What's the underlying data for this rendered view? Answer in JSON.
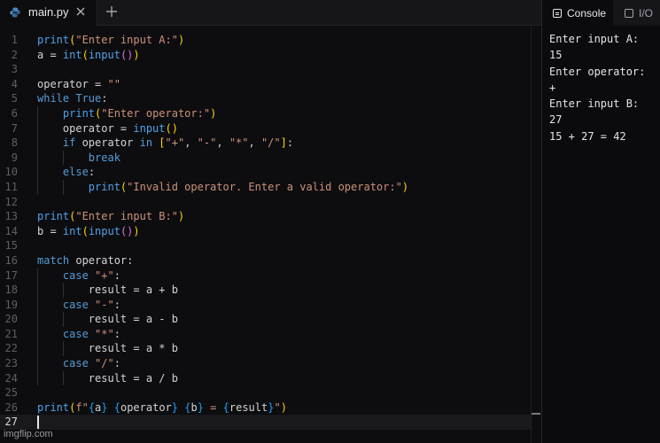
{
  "editor": {
    "tab_title": "main.py",
    "lines": [
      "1",
      "2",
      "3",
      "4",
      "5",
      "6",
      "7",
      "8",
      "9",
      "10",
      "11",
      "12",
      "13",
      "14",
      "15",
      "16",
      "17",
      "18",
      "19",
      "20",
      "21",
      "22",
      "23",
      "24",
      "25",
      "26",
      "27"
    ]
  },
  "console": {
    "tab_console": "Console",
    "tab_io": "I/O",
    "output": [
      "Enter input A:",
      "15",
      "Enter operator:",
      "+",
      "Enter input B:",
      "27",
      "15 + 27 = 42"
    ]
  },
  "watermark": "imgflip.com",
  "colors": {
    "keyword": "#569cd6",
    "string": "#ce9178",
    "bracket_yellow": "#ffd700",
    "bracket_purple": "#da70d6",
    "background": "#0d0d10"
  }
}
